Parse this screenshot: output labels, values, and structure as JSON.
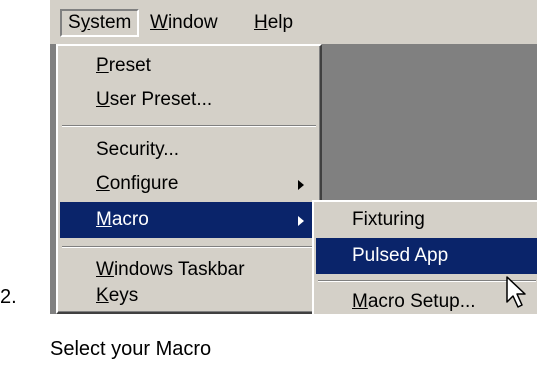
{
  "menubar": {
    "items": [
      {
        "pre": "S",
        "ul": "y",
        "post": "stem"
      },
      {
        "pre": "",
        "ul": "W",
        "post": "indow"
      },
      {
        "pre": "",
        "ul": "H",
        "post": "elp"
      }
    ]
  },
  "system_menu": {
    "items": [
      {
        "pre": "",
        "ul": "P",
        "post": "reset"
      },
      {
        "pre": "",
        "ul": "U",
        "post": "ser Preset..."
      },
      {
        "pre": "Security...",
        "ul": "",
        "post": ""
      },
      {
        "pre": "",
        "ul": "C",
        "post": "onfigure"
      },
      {
        "pre": "",
        "ul": "M",
        "post": "acro"
      },
      {
        "pre": "",
        "ul": "W",
        "post": "indows Taskbar"
      },
      {
        "pre": "",
        "ul": "K",
        "post": "eys"
      }
    ]
  },
  "macro_submenu": {
    "items": [
      {
        "pre": "Fixturing",
        "ul": "",
        "post": ""
      },
      {
        "pre": "Pulsed App",
        "ul": "",
        "post": ""
      },
      {
        "pre": "",
        "ul": "M",
        "post": "acro Setup..."
      }
    ]
  },
  "step_number": "2.",
  "caption": "Select your Macro",
  "colors": {
    "menu_bg": "#d4d0c8",
    "highlight": "#0a246a",
    "workspace": "#808080"
  }
}
